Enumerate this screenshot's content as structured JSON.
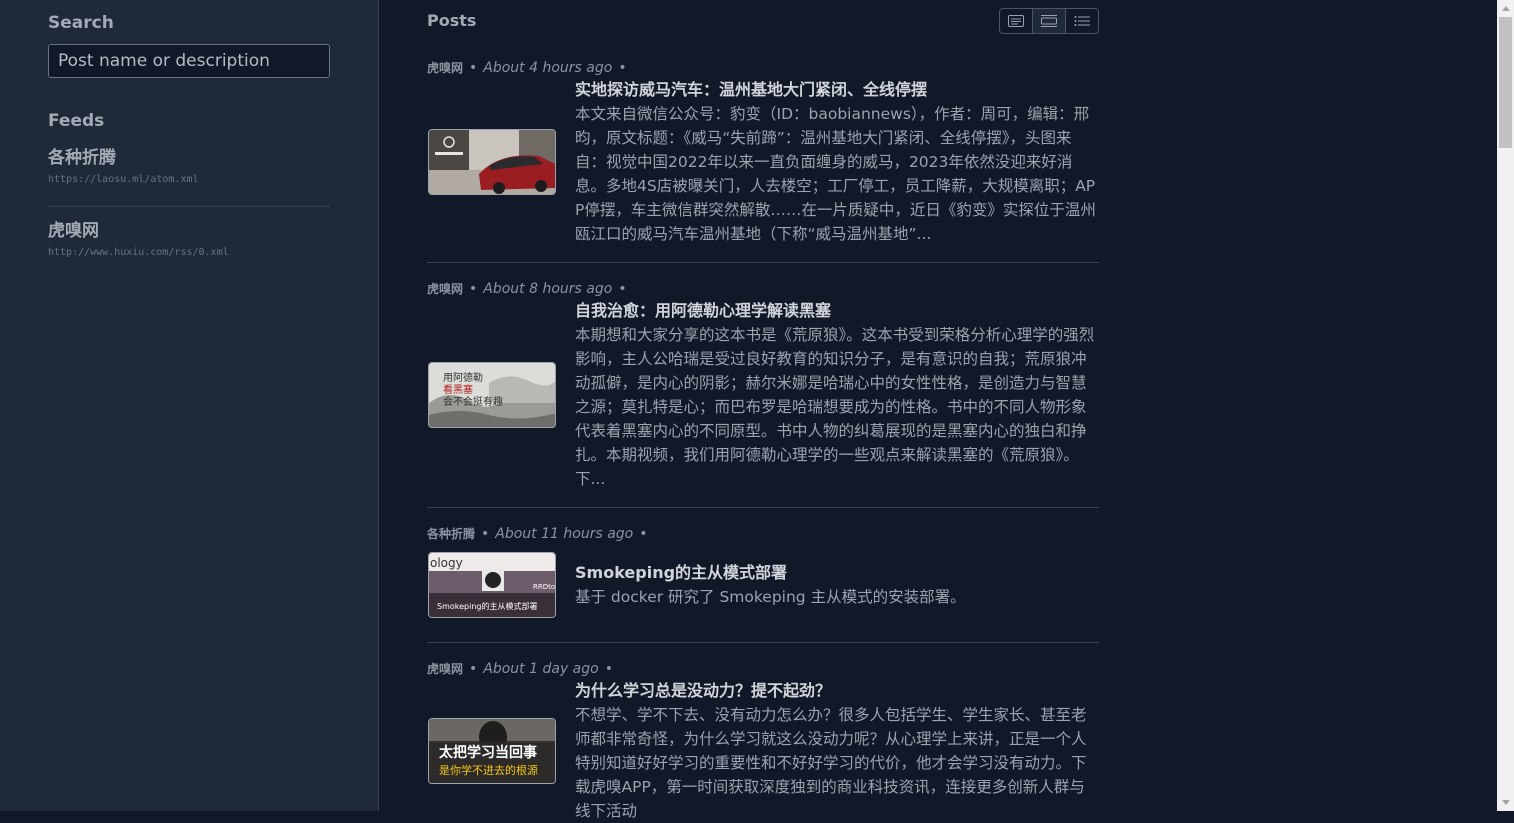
{
  "sidebar": {
    "search_heading": "Search",
    "search_placeholder": "Post name or description",
    "feeds_heading": "Feeds",
    "feeds": [
      {
        "name": "各种折腾",
        "url": "https://laosu.ml/atom.xml"
      },
      {
        "name": "虎嗅网",
        "url": "http://www.huxiu.com/rss/0.xml"
      }
    ]
  },
  "main": {
    "title": "Posts",
    "view_modes": [
      "card-view-icon",
      "compact-view-icon",
      "list-view-icon"
    ],
    "posts": [
      {
        "source": "虎嗅网",
        "time": "About 4 hours ago",
        "title": "实地探访威马汽车：温州基地大门紧闭、全线停摆",
        "description": "本文来自微信公众号：豹变（ID：baobiannews），作者：周可，编辑：邢昀，原文标题：《威马“失前蹄”：温州基地大门紧闭、全线停摆》，头图来自：视觉中国2022年以来一直负面缠身的威马，2023年依然没迎来好消息。多地4S店被曝关门，人去楼空；工厂停工，员工降薪，大规模离职；APP停摆，车主微信群突然解散……在一片质疑中，近日《豹变》实探位于温州瓯江口的威马汽车温州基地（下称“威马温州基地”..."
      },
      {
        "source": "虎嗅网",
        "time": "About 8 hours ago",
        "title": "自我治愈：用阿德勒心理学解读黑塞",
        "description": "本期想和大家分享的这本书是《荒原狼》。这本书受到荣格分析心理学的强烈影响，主人公哈瑞是受过良好教育的知识分子，是有意识的自我；荒原狼冲动孤僻，是内心的阴影；赫尔米娜是哈瑞心中的女性性格，是创造力与智慧之源；莫扎特是心；而巴布罗是哈瑞想要成为的性格。书中的不同人物形象代表着黑塞内心的不同原型。书中人物的纠葛展现的是黑塞内心的独白和挣扎。本期视频，我们用阿德勒心理学的一些观点来解读黑塞的《荒原狼》。下...",
        "thumb_text": [
          "用阿德勒",
          "看黑塞",
          "会不会挺有趣"
        ]
      },
      {
        "source": "各种折腾",
        "time": "About 11 hours ago",
        "title": "Smokeping的主从模式部署",
        "description": "基于 docker 研究了 Smokeping 主从模式的安装部署。",
        "thumb_text": [
          "ology",
          "Smokeping的主从模式部署",
          "RRDto"
        ]
      },
      {
        "source": "虎嗅网",
        "time": "About 1 day ago",
        "title": "为什么学习总是没动力？提不起劲？",
        "description": "不想学、学不下去、没有动力怎么办？很多人包括学生、学生家长、甚至老师都非常奇怪，为什么学习就这么没动力呢？从心理学上来讲，正是一个人特别知道好好学习的重要性和不好好学习的代价，他才会学习没有动力。下载虎嗅APP，第一时间获取深度独到的商业科技资讯，连接更多创新人群与线下活动",
        "thumb_text": [
          "太把学习当回事",
          "是你学不进去的根源"
        ]
      }
    ]
  }
}
